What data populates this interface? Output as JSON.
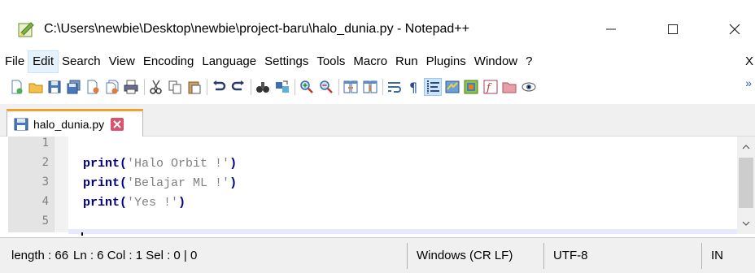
{
  "window": {
    "title": "C:\\Users\\newbie\\Desktop\\newbie\\project-baru\\halo_dunia.py - Notepad++"
  },
  "menu": {
    "items": [
      "File",
      "Edit",
      "Search",
      "View",
      "Encoding",
      "Language",
      "Settings",
      "Tools",
      "Macro",
      "Run",
      "Plugins",
      "Window",
      "?"
    ],
    "close_x": "X"
  },
  "toolbar": {
    "more": "»"
  },
  "tab": {
    "label": "halo_dunia.py"
  },
  "editor": {
    "line_numbers": [
      "1",
      "2",
      "3",
      "4",
      "5"
    ],
    "lines": [
      {
        "fn": "",
        "open": "",
        "str": "",
        "close": ""
      },
      {
        "fn": "print",
        "open": "(",
        "str": "'Halo Orbit !'",
        "close": ")"
      },
      {
        "fn": "print",
        "open": "(",
        "str": "'Belajar ML !'",
        "close": ")"
      },
      {
        "fn": "print",
        "open": "(",
        "str": "'Yes !'",
        "close": ")"
      },
      {
        "fn": "",
        "open": "",
        "str": "",
        "close": ""
      }
    ]
  },
  "status": {
    "length": "length : 66",
    "position": "Ln : 6    Col : 1    Sel : 0 | 0",
    "eol": "Windows (CR LF)",
    "encoding": "UTF-8",
    "mode": "IN"
  },
  "colors": {
    "keyword": "#000080",
    "string": "#808080",
    "tab_accent": "#f0a030",
    "tab_close": "#d8536d"
  }
}
